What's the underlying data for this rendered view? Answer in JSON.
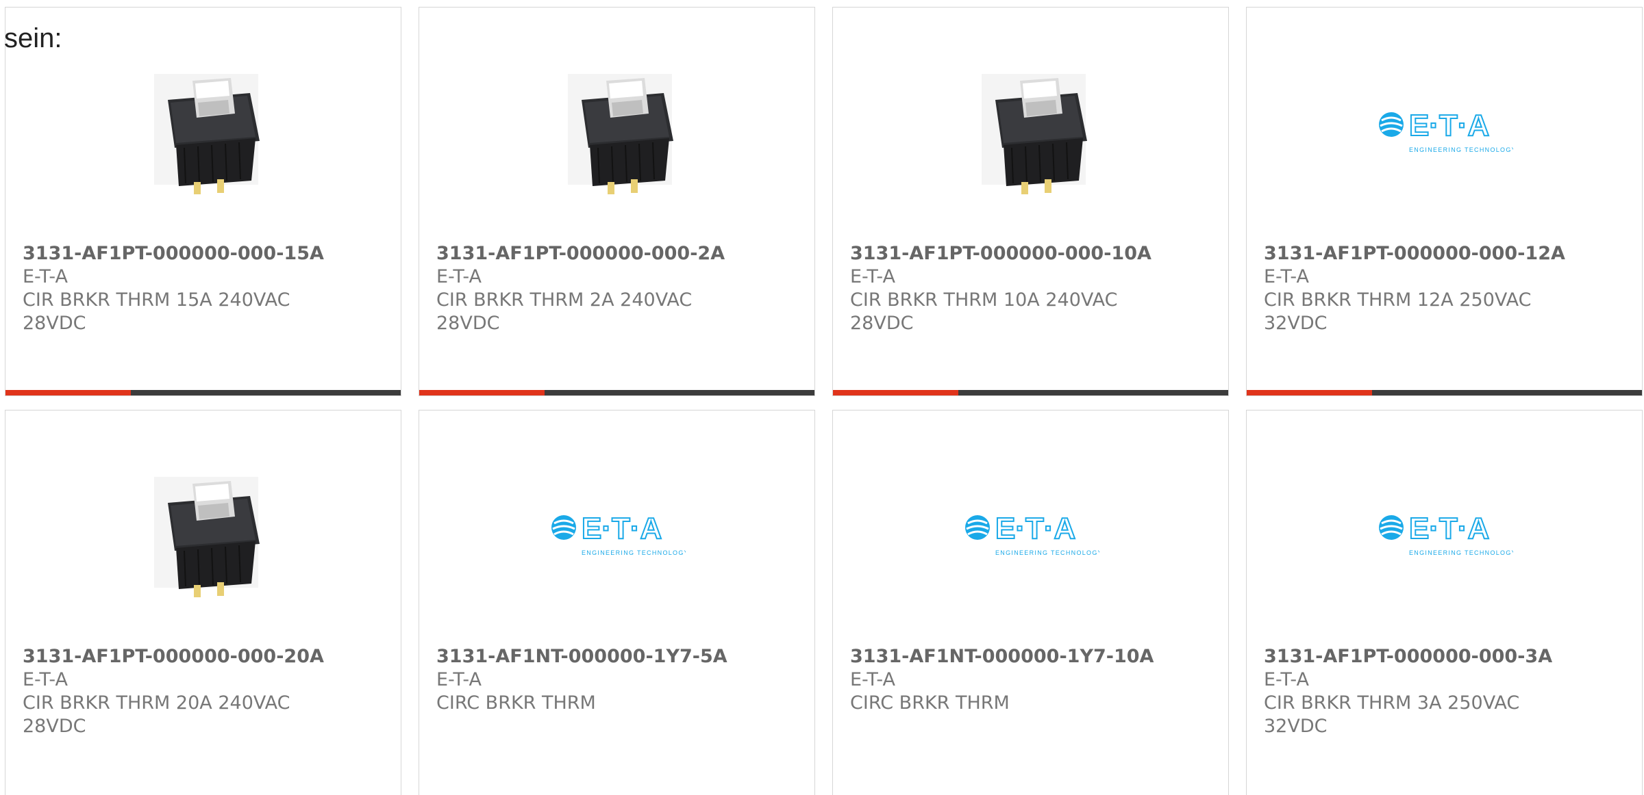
{
  "intro_text": "sein:",
  "colors": {
    "accent": "#e0341b",
    "bar": "#3c3c3c",
    "logo": "#1aa9e8"
  },
  "products": [
    {
      "part_number": "3131-AF1PT-000000-000-15A",
      "manufacturer": "E-T-A",
      "desc1": "CIR BRKR THRM 15A 240VAC",
      "desc2": "28VDC",
      "image": "circuit-breaker-photo"
    },
    {
      "part_number": "3131-AF1PT-000000-000-2A",
      "manufacturer": "E-T-A",
      "desc1": "CIR BRKR THRM 2A 240VAC",
      "desc2": "28VDC",
      "image": "circuit-breaker-photo"
    },
    {
      "part_number": "3131-AF1PT-000000-000-10A",
      "manufacturer": "E-T-A",
      "desc1": "CIR BRKR THRM 10A 240VAC",
      "desc2": "28VDC",
      "image": "circuit-breaker-photo"
    },
    {
      "part_number": "3131-AF1PT-000000-000-12A",
      "manufacturer": "E-T-A",
      "desc1": "CIR BRKR THRM 12A 250VAC",
      "desc2": "32VDC",
      "image": "eta-logo"
    },
    {
      "part_number": "3131-AF1PT-000000-000-20A",
      "manufacturer": "E-T-A",
      "desc1": "CIR BRKR THRM 20A 240VAC",
      "desc2": "28VDC",
      "image": "circuit-breaker-photo"
    },
    {
      "part_number": "3131-AF1NT-000000-1Y7-5A",
      "manufacturer": "E-T-A",
      "desc1": "CIRC BRKR THRM",
      "desc2": "",
      "image": "eta-logo"
    },
    {
      "part_number": "3131-AF1NT-000000-1Y7-10A",
      "manufacturer": "E-T-A",
      "desc1": "CIRC BRKR THRM",
      "desc2": "",
      "image": "eta-logo"
    },
    {
      "part_number": "3131-AF1PT-000000-000-3A",
      "manufacturer": "E-T-A",
      "desc1": "CIR BRKR THRM 3A 250VAC",
      "desc2": "32VDC",
      "image": "eta-logo"
    }
  ],
  "logo": {
    "wordmark": "E·T·A",
    "tagline": "ENGINEERING TECHNOLOGY"
  }
}
